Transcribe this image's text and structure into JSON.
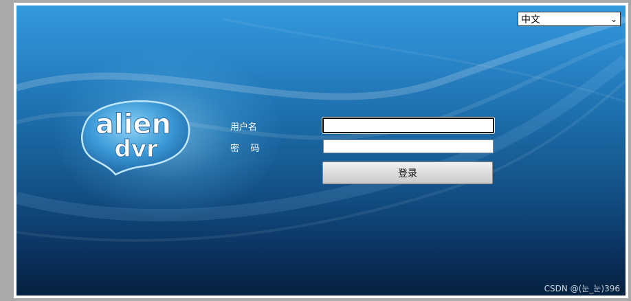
{
  "language": {
    "selected": "中文"
  },
  "logo": {
    "line1": "alien",
    "line2": "dvr"
  },
  "form": {
    "username_label": "用户名",
    "password_label": "密    码",
    "username_value": "",
    "password_value": "",
    "login_label": "登录"
  },
  "watermark": "CSDN @(눈_눈)396",
  "colors": {
    "background_top": "#3399dd",
    "background_bottom": "#06213f",
    "outer_gray": "#a9a9a9"
  },
  "icons": [
    "chevron-down-icon",
    "alien-dvr-logo"
  ]
}
